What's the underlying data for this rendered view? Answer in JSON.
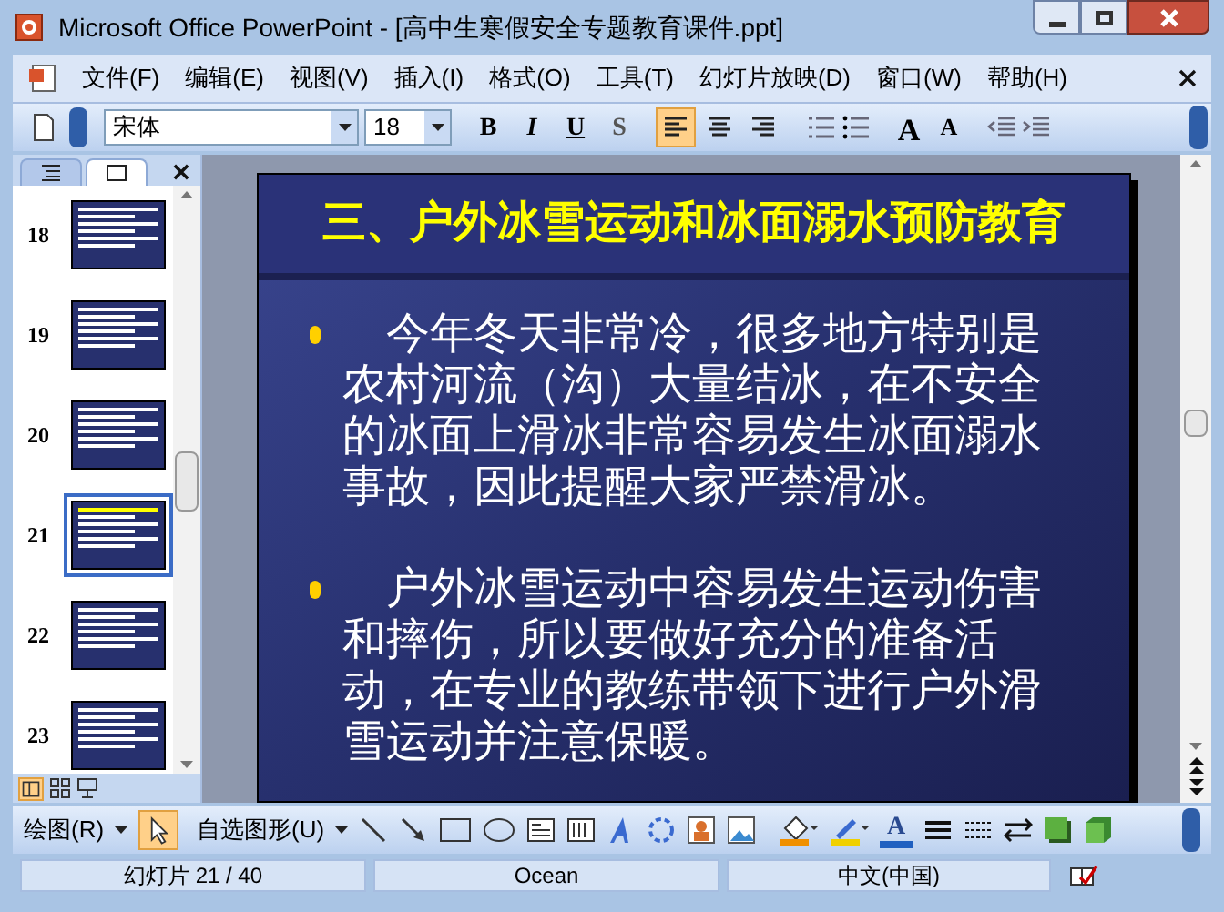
{
  "window": {
    "title": "Microsoft Office PowerPoint - [高中生寒假安全专题教育课件.ppt]"
  },
  "menu": [
    "文件(F)",
    "编辑(E)",
    "视图(V)",
    "插入(I)",
    "格式(O)",
    "工具(T)",
    "幻灯片放映(D)",
    "窗口(W)",
    "帮助(H)"
  ],
  "toolbar": {
    "font": "宋体",
    "size": "18",
    "styles": [
      "B",
      "I",
      "U",
      "S"
    ],
    "alignments": [
      {
        "kind": "left",
        "selected": true
      },
      {
        "kind": "center",
        "selected": false
      },
      {
        "kind": "right",
        "selected": false
      }
    ],
    "font_size_buttons": [
      "A",
      "A"
    ]
  },
  "pane_tabs": [
    {
      "kind": "outline",
      "selected": false
    },
    {
      "kind": "slides",
      "selected": true
    }
  ],
  "slides": [
    {
      "number": "18",
      "selected": false
    },
    {
      "number": "19",
      "selected": false
    },
    {
      "number": "20",
      "selected": false
    },
    {
      "number": "21",
      "selected": true
    },
    {
      "number": "22",
      "selected": false
    },
    {
      "number": "23",
      "selected": false
    }
  ],
  "slide": {
    "title": "三、户外冰雪运动和冰面溺水预防教育",
    "bullets": [
      "今年冬天非常冷，很多地方特别是农村河流（沟）大量结冰，在不安全的冰面上滑冰非常容易发生冰面溺水事故，因此提醒大家严禁滑冰。",
      "户外冰雪运动中容易发生运动伤害和摔伤，所以要做好充分的准备活动，在专业的教练带领下进行户外滑雪运动并注意保暖。"
    ]
  },
  "drawing_toolbar": {
    "draw_menu": "绘图(R)",
    "autoshapes": "自选图形(U)",
    "font_color": "A"
  },
  "status_bar": [
    "幻灯片 21 / 40",
    "Ocean",
    "中文(中国)"
  ]
}
